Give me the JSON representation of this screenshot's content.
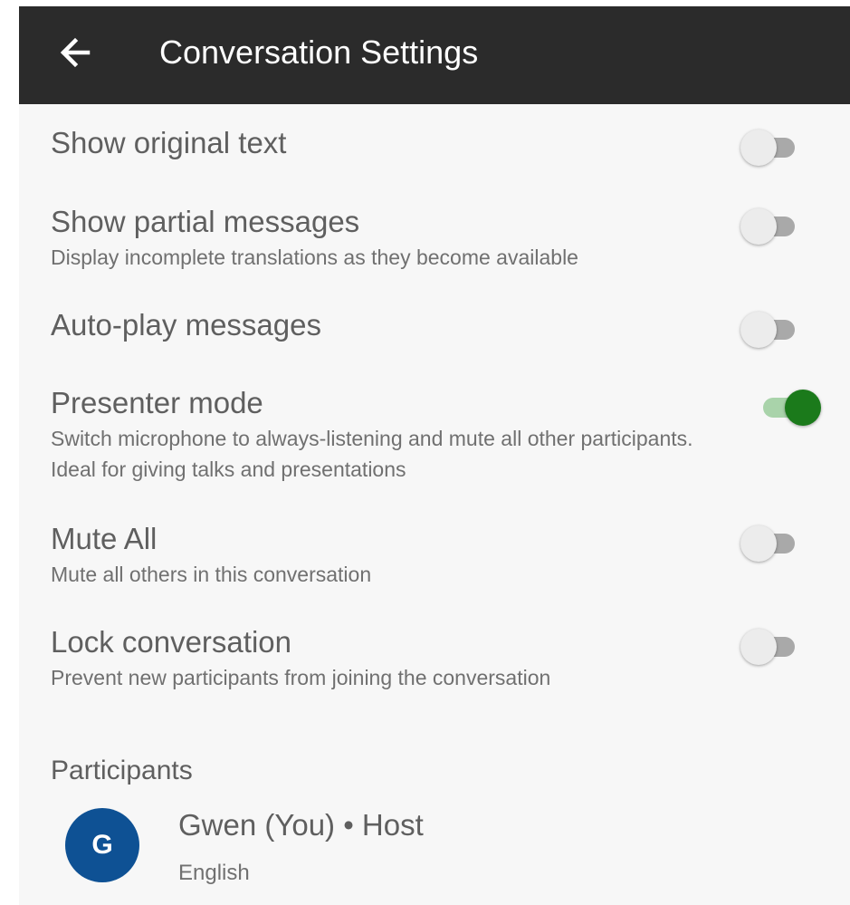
{
  "header": {
    "title": "Conversation Settings",
    "back_icon": "arrow-left-icon"
  },
  "settings": [
    {
      "title": "Show original text",
      "description": "",
      "enabled": false
    },
    {
      "title": "Show partial messages",
      "description": "Display incomplete translations as they become available",
      "enabled": false
    },
    {
      "title": "Auto-play messages",
      "description": "",
      "enabled": false
    },
    {
      "title": "Presenter mode",
      "description": "Switch microphone to always-listening and mute all other participants. Ideal for giving talks and presentations",
      "enabled": true
    },
    {
      "title": "Mute All",
      "description": "Mute all others in this conversation",
      "enabled": false
    },
    {
      "title": "Lock conversation",
      "description": "Prevent new participants from joining the conversation",
      "enabled": false
    }
  ],
  "participants": {
    "header": "Participants",
    "list": [
      {
        "initial": "G",
        "name": "Gwen (You) • Host",
        "language": "English"
      }
    ]
  },
  "colors": {
    "appbar": "#2b2b2b",
    "toggle_on": "#1b7a1b",
    "avatar": "#0e5194"
  }
}
